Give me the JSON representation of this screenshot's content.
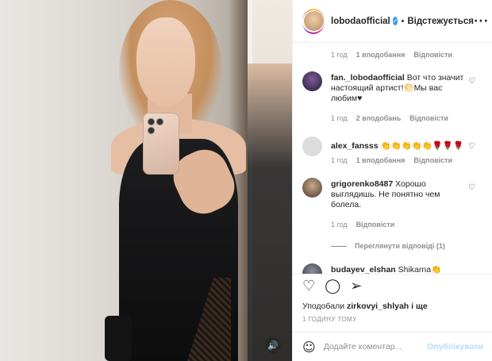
{
  "post": {
    "username": "lobodaofficial",
    "follow_status": "Відстежується",
    "likes_prefix": "Уподобали",
    "likes_user": "zirkovyi_shlyah",
    "likes_suffix": "і ще",
    "timestamp": "1 ГОДИНУ ТОМУ",
    "add_comment_placeholder": "Додайте коментар...",
    "publish_label": "Опублікувати"
  },
  "comments": [
    {
      "time": "1 год",
      "likes": "1 вподобання",
      "reply": "Відповісти"
    },
    {
      "username": "fan._lobodaofficial",
      "text": "Вот что значит настоящий артист!🌕Мы вас любим♥",
      "time": "1 год",
      "likes": "2 вподобань",
      "reply": "Відповісти"
    },
    {
      "username": "alex_fansss",
      "text": "👏👏👏👏👏🌹🌹🌹",
      "time": "1 год",
      "likes": "1 вподобання",
      "reply": "Відповісти"
    },
    {
      "username": "grigorenko8487",
      "text": "Хорошо выглядишь. Не понятно чем болела.",
      "time": "1 год",
      "reply": "Відповісти",
      "view_replies": "Переглянути відповіді (1)"
    },
    {
      "username": "budayev_elshan",
      "text": "Shikarna👏"
    }
  ],
  "colors": {
    "text": "#262626",
    "secondary": "#8e8e8e",
    "verified": "#3897f0",
    "publish_disabled": "#b2dffc"
  }
}
